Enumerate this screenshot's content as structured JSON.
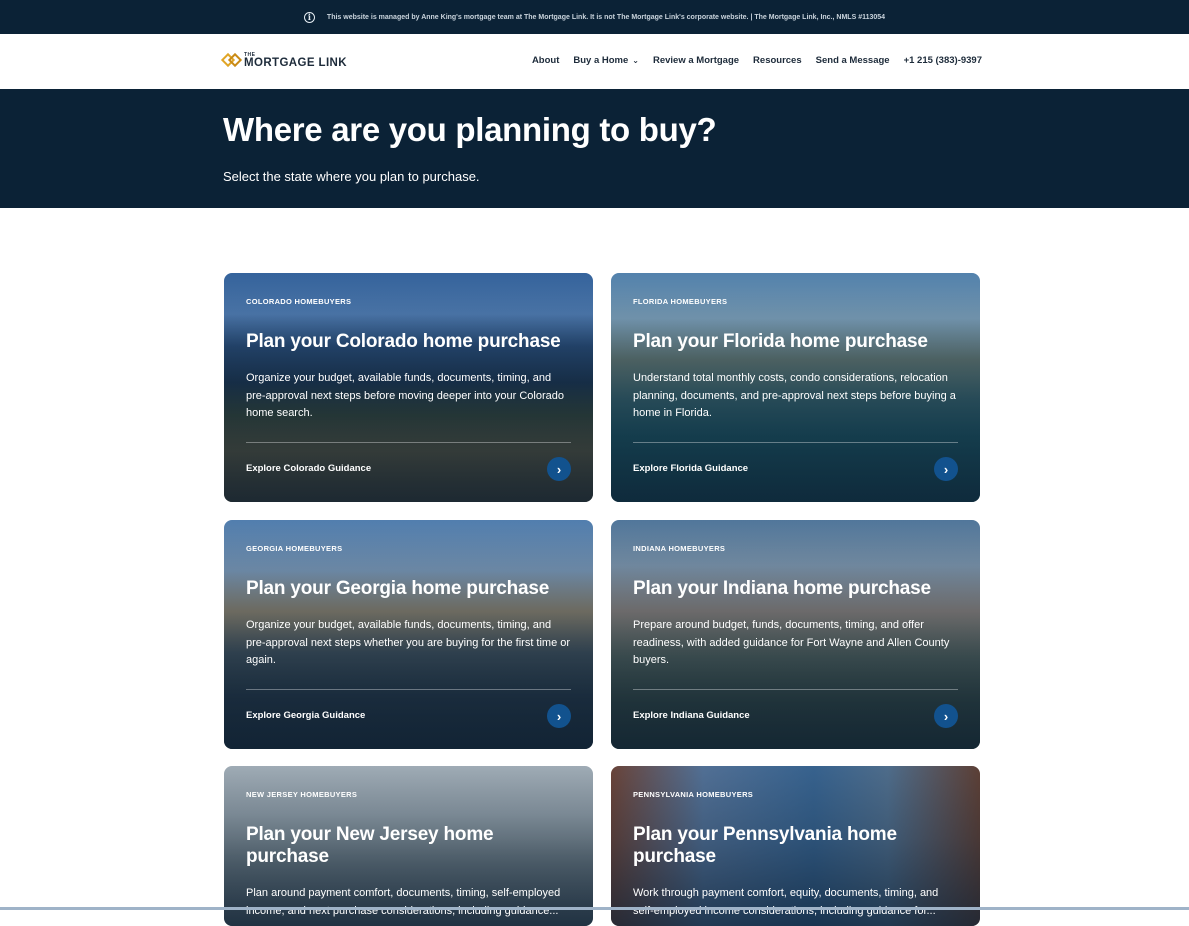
{
  "topbar": {
    "icon": "info-icon",
    "text": "This website is managed by Anne King's mortgage team at The Mortgage Link. It is not The Mortgage Link's corporate website. | The Mortgage Link, Inc., NMLS #113054"
  },
  "header": {
    "logo_the": "THE",
    "logo_name": "MORTGAGE LINK",
    "nav": {
      "about": "About",
      "buy": "Buy a Home",
      "review": "Review a Mortgage",
      "resources": "Resources",
      "message": "Send a Message",
      "phone": "+1 215 (383)-9397"
    }
  },
  "hero": {
    "title": "Where are you planning to buy?",
    "subtitle": "Select the state where you plan to purchase."
  },
  "cards": [
    {
      "eyebrow": "COLORADO HOMEBUYERS",
      "title": "Plan your Colorado home purchase",
      "description": "Organize your budget, available funds, documents, timing, and pre-approval next steps before moving deeper into your Colorado home search.",
      "cta": "Explore Colorado Guidance"
    },
    {
      "eyebrow": "FLORIDA HOMEBUYERS",
      "title": "Plan your Florida home purchase",
      "description": "Understand total monthly costs, condo considerations, relocation planning, documents, and pre-approval next steps before buying a home in Florida.",
      "cta": "Explore Florida Guidance"
    },
    {
      "eyebrow": "GEORGIA HOMEBUYERS",
      "title": "Plan your Georgia home purchase",
      "description": "Organize your budget, available funds, documents, timing, and pre-approval next steps whether you are buying for the first time or again.",
      "cta": "Explore Georgia Guidance"
    },
    {
      "eyebrow": "INDIANA HOMEBUYERS",
      "title": "Plan your Indiana home purchase",
      "description": "Prepare around budget, funds, documents, timing, and offer readiness, with added guidance for Fort Wayne and Allen County buyers.",
      "cta": "Explore Indiana Guidance"
    },
    {
      "eyebrow": "NEW JERSEY HOMEBUYERS",
      "title": "Plan your New Jersey home purchase",
      "description": "Plan around payment comfort, documents, timing, self-employed income, and next purchase considerations, including guidance..."
    },
    {
      "eyebrow": "PENNSYLVANIA HOMEBUYERS",
      "title": "Plan your Pennsylvania home purchase",
      "description": "Work through payment comfort, equity, documents, timing, and self-employed income considerations, including guidance for..."
    }
  ],
  "colors": {
    "navy": "#0b2236",
    "accent_blue": "#12528e",
    "logo_gold": "#e0a526"
  }
}
